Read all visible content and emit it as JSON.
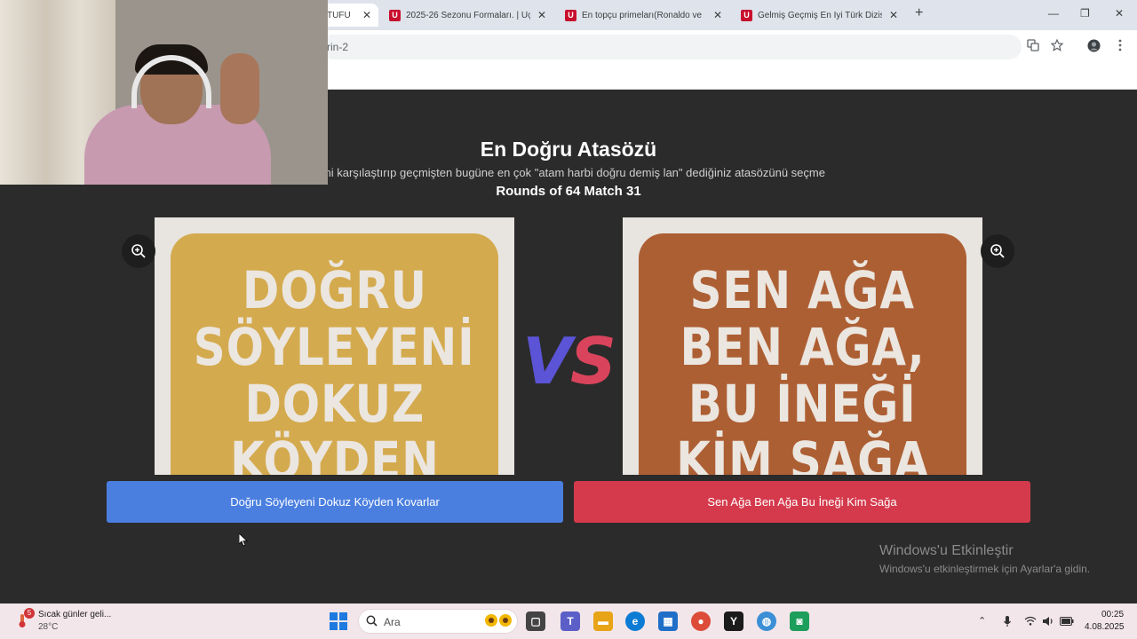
{
  "browser": {
    "tabs": [
      {
        "label": "TUFU",
        "active": true
      },
      {
        "label": "2025-26 Sezonu Formaları. | Uç",
        "favicon": "U"
      },
      {
        "label": "En topçu primeları(Ronaldo ve ",
        "favicon": "U"
      },
      {
        "label": "Gelmiş Geçmiş En İyi Türk Dizisi",
        "favicon": "U"
      }
    ],
    "new_tab": "+",
    "url": "rin-2",
    "window": {
      "minimize": "—",
      "restore": "❐",
      "close": "✕"
    },
    "colors": {
      "favicon": "#c8102e"
    }
  },
  "page": {
    "title": "En Doğru Atasözü",
    "description": "erini karşılaştırıp geçmişten bugüne en çok \"atam harbi doğru demiş lan\" dediğiniz atasözünü seçme",
    "round": "Rounds of 64 Match 31",
    "vs": {
      "v": "V",
      "s": "S"
    },
    "left": {
      "poster_lines": [
        "DOĞRU",
        "SÖYLEYENİ",
        "DOKUZ",
        "KÖYDEN"
      ],
      "button": "Doğru Söyleyeni Dokuz Köyden Kovarlar",
      "color": "#4a7fe0"
    },
    "right": {
      "poster_lines": [
        "SEN AĞA",
        "BEN AĞA,",
        "BU İNEĞİ",
        "KİM SAĞA"
      ],
      "button": "Sen Ağa Ben Ağa Bu İneği Kim Sağa",
      "color": "#d43a4c"
    }
  },
  "watermark": {
    "title": "Windows'u Etkinleştir",
    "subtitle": "Windows'u etkinleştirmek için Ayarlar'a gidin."
  },
  "taskbar": {
    "weather": {
      "text": "Sıcak günler geli...",
      "temp": "28°C",
      "badge": "5"
    },
    "search_label": "Ara",
    "apps": [
      {
        "name": "task-view",
        "glyph": "▢",
        "color": "#444444"
      },
      {
        "name": "teams",
        "glyph": "T",
        "color": "#5b5fc7"
      },
      {
        "name": "file-explorer",
        "glyph": "▬",
        "color": "#e8a417"
      },
      {
        "name": "edge",
        "glyph": "e",
        "color": "#0c7bd4"
      },
      {
        "name": "store",
        "glyph": "▦",
        "color": "#1f6fc8"
      },
      {
        "name": "chrome",
        "glyph": "●",
        "color": "#dd4b39"
      },
      {
        "name": "yandex",
        "glyph": "Y",
        "color": "#1b1b1b"
      },
      {
        "name": "globe-app",
        "glyph": "◍",
        "color": "#3a8fd6"
      },
      {
        "name": "android-app",
        "glyph": "◙",
        "color": "#1e9e5c"
      }
    ],
    "clock": {
      "time": "00:25",
      "date": "4.08.2025"
    }
  }
}
